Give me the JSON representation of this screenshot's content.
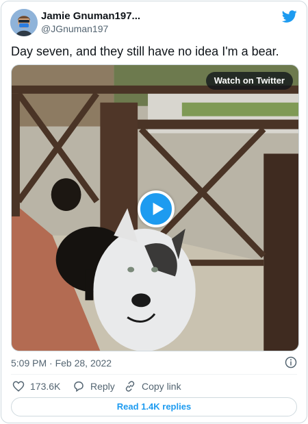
{
  "author": {
    "name": "Jamie Gnuman197...",
    "handle": "@JGnuman197",
    "avatar_icon": "user-avatar"
  },
  "tweet": {
    "text": "Day seven, and they still have no idea I'm a bear.",
    "timestamp": "5:09 PM · Feb 28, 2022"
  },
  "media": {
    "watch_label": "Watch on Twitter",
    "play_icon": "play-icon"
  },
  "actions": {
    "likes": "173.6K",
    "reply_label": "Reply",
    "copy_label": "Copy link"
  },
  "read_replies_label": "Read 1.4K replies",
  "colors": {
    "accent": "#1d9bf0",
    "text": "#0f1419",
    "secondary": "#536471",
    "border": "#cfd9de"
  }
}
